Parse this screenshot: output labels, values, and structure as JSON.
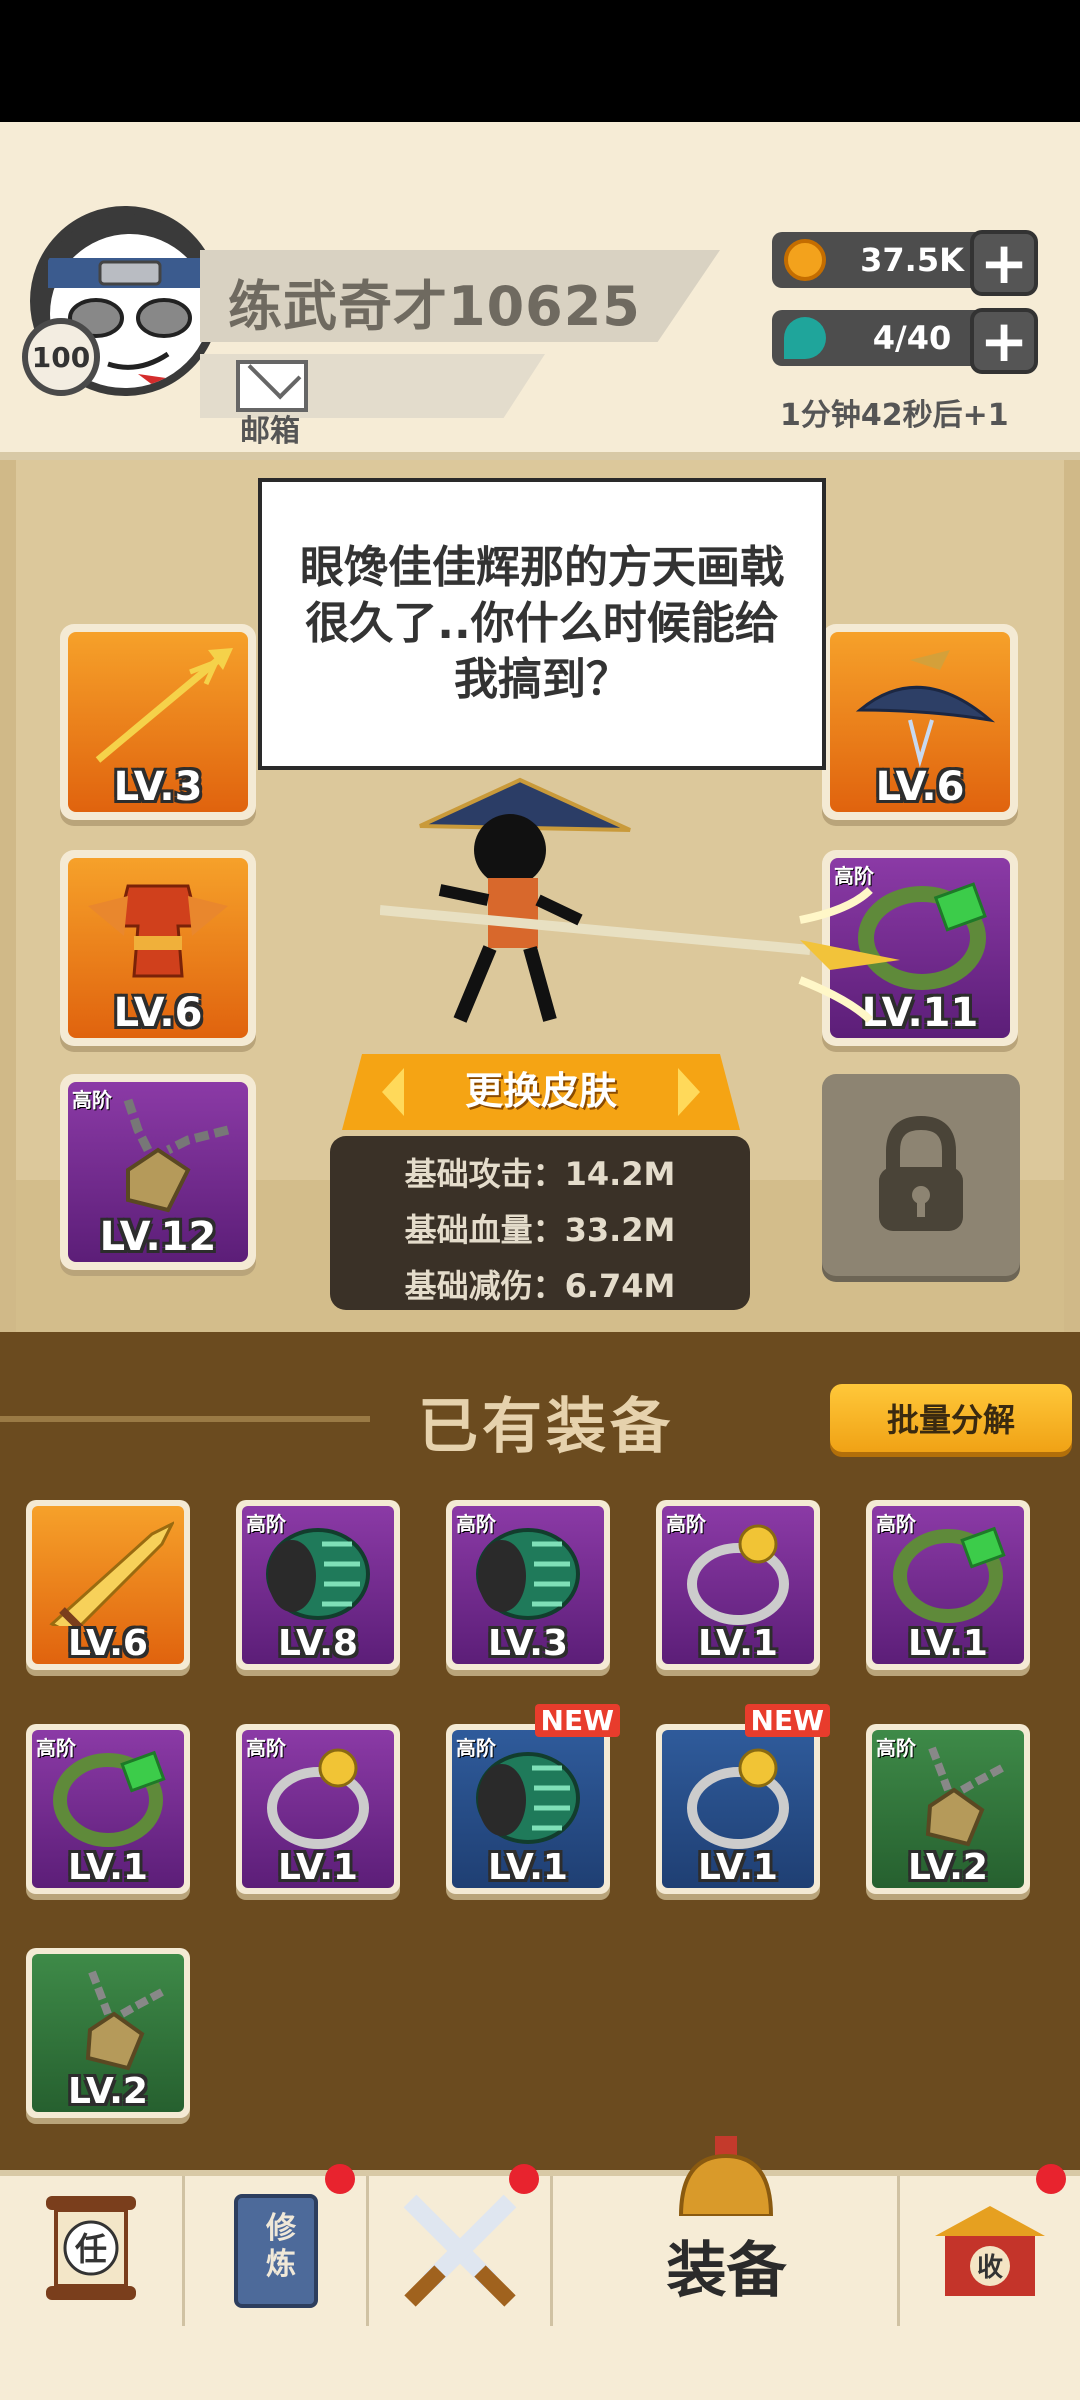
{
  "header": {
    "player_name": "练武奇才10625",
    "level": "100",
    "mail_label": "邮箱",
    "coins": "37.5K",
    "energy": "4/40",
    "energy_timer": "1分钟42秒后+1"
  },
  "stage": {
    "speech": "眼馋佳佳辉那的方天画戟很久了..你什么时候能给我搞到？",
    "change_skin_label": "更换皮肤",
    "stats": [
      "基础攻击：14.2M",
      "基础血量：33.2M",
      "基础减伤：6.74M"
    ],
    "equipped": {
      "weapon": {
        "level": "LV.3",
        "tier": "",
        "icon": "spear-icon"
      },
      "armor": {
        "level": "LV.6",
        "tier": "",
        "icon": "armor-icon"
      },
      "necklace": {
        "level": "LV.12",
        "tier": "高阶",
        "icon": "necklace-icon"
      },
      "hat": {
        "level": "LV.6",
        "tier": "",
        "icon": "straw-hat-icon"
      },
      "bracelet": {
        "level": "LV.11",
        "tier": "高阶",
        "icon": "bracelet-icon"
      }
    }
  },
  "inventory": {
    "title": "已有装备",
    "bulk_button": "批量分解",
    "items": [
      {
        "level": "LV.6",
        "tier": "",
        "new": "",
        "icon": "sword-icon",
        "color": "orange"
      },
      {
        "level": "LV.8",
        "tier": "高阶",
        "new": "",
        "icon": "gauntlet-icon",
        "color": "purple"
      },
      {
        "level": "LV.3",
        "tier": "高阶",
        "new": "",
        "icon": "gauntlet-icon",
        "color": "purple"
      },
      {
        "level": "LV.1",
        "tier": "高阶",
        "new": "",
        "icon": "ring-icon",
        "color": "purple"
      },
      {
        "level": "LV.1",
        "tier": "高阶",
        "new": "",
        "icon": "bracelet-icon",
        "color": "purple"
      },
      {
        "level": "LV.1",
        "tier": "高阶",
        "new": "",
        "icon": "bracelet-icon",
        "color": "purple"
      },
      {
        "level": "LV.1",
        "tier": "高阶",
        "new": "",
        "icon": "ring-icon",
        "color": "purple"
      },
      {
        "level": "LV.1",
        "tier": "高阶",
        "new": "NEW",
        "icon": "gauntlet-icon",
        "color": "blue"
      },
      {
        "level": "LV.1",
        "tier": "",
        "new": "NEW",
        "icon": "ring-icon",
        "color": "blue"
      },
      {
        "level": "LV.2",
        "tier": "高阶",
        "new": "",
        "icon": "necklace-icon",
        "color": "green"
      },
      {
        "level": "LV.2",
        "tier": "",
        "new": "",
        "icon": "necklace-icon",
        "color": "green"
      }
    ]
  },
  "nav": {
    "task_char": "任",
    "cultivate_chars": "修炼",
    "equip_label": "装备",
    "shop_char": "收",
    "dot_color": "#e8232e"
  },
  "colors": {
    "orange": "#f08a1c",
    "purple": "#6e2a8c",
    "blue": "#2a4f8a",
    "green": "#357a3f",
    "accent": "#f0a215"
  }
}
